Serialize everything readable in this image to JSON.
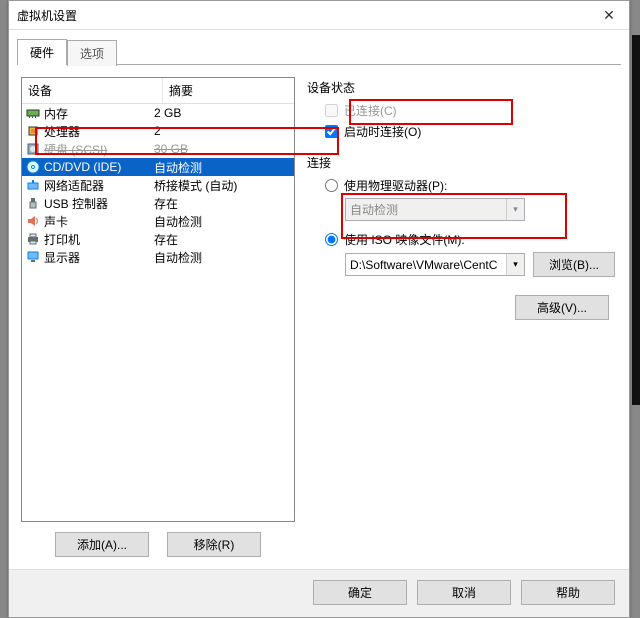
{
  "window": {
    "title": "虚拟机设置"
  },
  "tabs": {
    "hardware": "硬件",
    "options": "选项"
  },
  "table": {
    "headers": {
      "device": "设备",
      "summary": "摘要"
    },
    "rows": [
      {
        "icon": "memory-icon",
        "name": "内存",
        "summary": "2 GB"
      },
      {
        "icon": "cpu-icon",
        "name": "处理器",
        "summary": "2"
      },
      {
        "icon": "disk-icon",
        "name": "硬盘 (SCSI)",
        "summary": "30 GB",
        "strike": true
      },
      {
        "icon": "cd-icon",
        "name": "CD/DVD (IDE)",
        "summary": "自动检测",
        "selected": true
      },
      {
        "icon": "net-icon",
        "name": "网络适配器",
        "summary": "桥接模式 (自动)"
      },
      {
        "icon": "usb-icon",
        "name": "USB 控制器",
        "summary": "存在"
      },
      {
        "icon": "sound-icon",
        "name": "声卡",
        "summary": "自动检测"
      },
      {
        "icon": "printer-icon",
        "name": "打印机",
        "summary": "存在"
      },
      {
        "icon": "display-icon",
        "name": "显示器",
        "summary": "自动检测"
      }
    ]
  },
  "left_buttons": {
    "add": "添加(A)...",
    "remove": "移除(R)"
  },
  "right": {
    "device_state": {
      "title": "设备状态",
      "connected": "已连接(C)",
      "connect_at_power_on": "启动时连接(O)"
    },
    "connection": {
      "title": "连接",
      "use_physical": "使用物理驱动器(P):",
      "physical_value": "自动检测",
      "use_iso": "使用 ISO 映像文件(M):",
      "iso_value": "D:\\Software\\VMware\\CentC",
      "browse": "浏览(B)..."
    },
    "advanced": "高级(V)..."
  },
  "bottom": {
    "ok": "确定",
    "cancel": "取消",
    "help": "帮助"
  }
}
